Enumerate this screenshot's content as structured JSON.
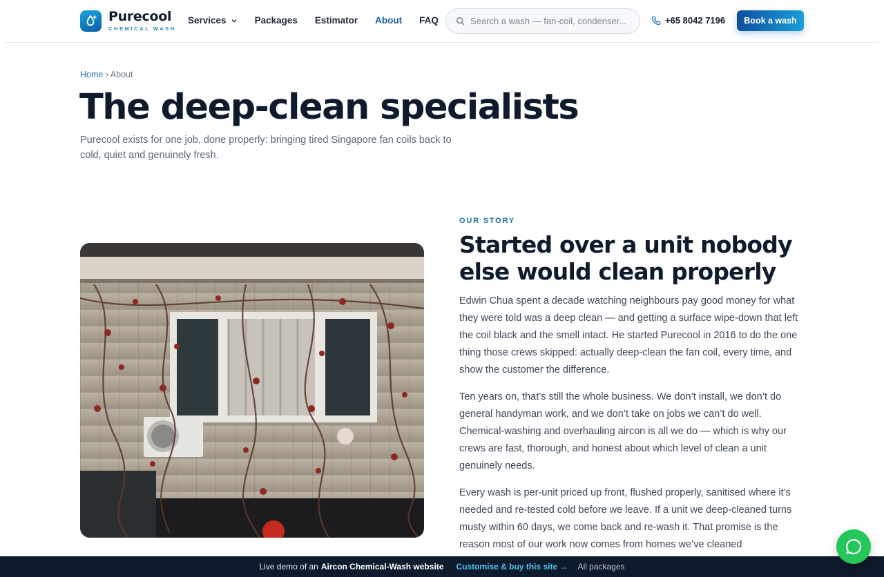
{
  "brand": {
    "name": "Purecool",
    "tagline": "CHEMICAL WASH"
  },
  "nav": {
    "items": [
      {
        "label": "Services",
        "has_dropdown": true
      },
      {
        "label": "Packages"
      },
      {
        "label": "Estimator"
      },
      {
        "label": "About",
        "active": true
      },
      {
        "label": "FAQ"
      }
    ]
  },
  "search": {
    "placeholder": "Search a wash — fan-coil, condenser..."
  },
  "phone": "+65 8042 7196",
  "cta": {
    "book_label": "Book a wash"
  },
  "breadcrumb": {
    "home": "Home",
    "separator": "›",
    "current": "About"
  },
  "hero": {
    "title": "The deep-clean specialists",
    "lede": "Purecool exists for one job, done properly: bringing tired Singapore fan coils back to cold, quiet and genuinely fresh."
  },
  "story": {
    "eyebrow": "OUR STORY",
    "title": "Started over a unit nobody else would clean properly",
    "paragraphs": [
      "Edwin Chua spent a decade watching neighbours pay good money for what they were told was a deep clean — and getting a surface wipe-down that left the coil black and the smell intact. He started Purecool in 2016 to do the one thing those crews skipped: actually deep-clean the fan coil, every time, and show the customer the difference.",
      "Ten years on, that’s still the whole business. We don’t install, we don’t do general handyman work, and we don’t take on jobs we can’t do well. Chemical-washing and overhauling aircon is all we do — which is why our crews are fast, thorough, and honest about which level of clean a unit genuinely needs.",
      "Every wash is per-unit priced up front, flushed properly, sanitised where it’s needed and re-tested cold before we leave. If a unit we deep-cleaned turns musty within 60 days, we come back and re-wash it. That promise is the reason most of our work now comes from homes we’ve cleaned"
    ]
  },
  "demo_bar": {
    "prefix": "Live demo of an",
    "site_type": "Aircon Chemical-Wash website",
    "buy_link": "Customise & buy this site →",
    "all_link": "All packages"
  },
  "colors": {
    "primary": "#1a5fa6",
    "accent": "#1a9fd8",
    "dark": "#0f1b2d",
    "chat": "#25c65a"
  }
}
